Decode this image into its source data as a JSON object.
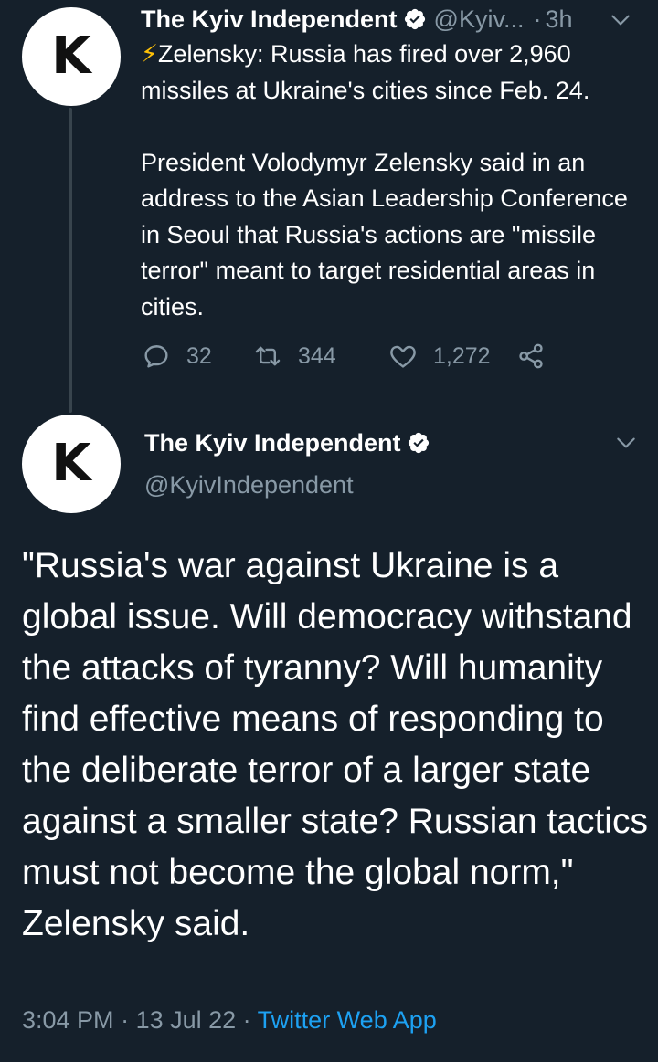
{
  "colors": {
    "background": "#15202b",
    "text": "#ffffff",
    "muted": "#8899a6",
    "link": "#1da1f2",
    "verified_badge": "#ffffff",
    "thread_line": "#38444d"
  },
  "tweet1": {
    "avatar_letter": "K",
    "author_name": "The Kyiv Independent",
    "handle": "@Kyiv...",
    "separator": "·",
    "time_ago": "3h",
    "icons": [
      "verified-badge-icon",
      "chevron-down-icon"
    ],
    "headline_emoji": "⚡",
    "headline": "Zelensky: Russia has fired over 2,960 missiles at Ukraine's cities since Feb. 24.",
    "paragraph": "President Volodymyr Zelensky said in an address to the Asian Leadership Conference in Seoul that Russia's actions are \"missile terror\" meant to target residential areas in cities.",
    "actions": {
      "replies": "32",
      "retweets": "344",
      "likes": "1,272",
      "icons": [
        "reply-icon",
        "retweet-icon",
        "like-icon",
        "share-icon"
      ]
    }
  },
  "tweet2": {
    "avatar_letter": "K",
    "author_name": "The Kyiv Independent",
    "handle": "@KyivIndependent",
    "icons": [
      "verified-badge-icon",
      "chevron-down-icon"
    ],
    "body": "\"Russia's war against Ukraine is a global issue. Will democracy withstand the attacks of tyranny? Will humanity find effective means of responding to the deliberate terror of a larger state against a smaller state? Russian tactics must not become the global norm,\" Zelensky said.",
    "time": "3:04 PM",
    "sep1": " · ",
    "date": "13 Jul 22",
    "sep2": " · ",
    "source": "Twitter Web App"
  }
}
